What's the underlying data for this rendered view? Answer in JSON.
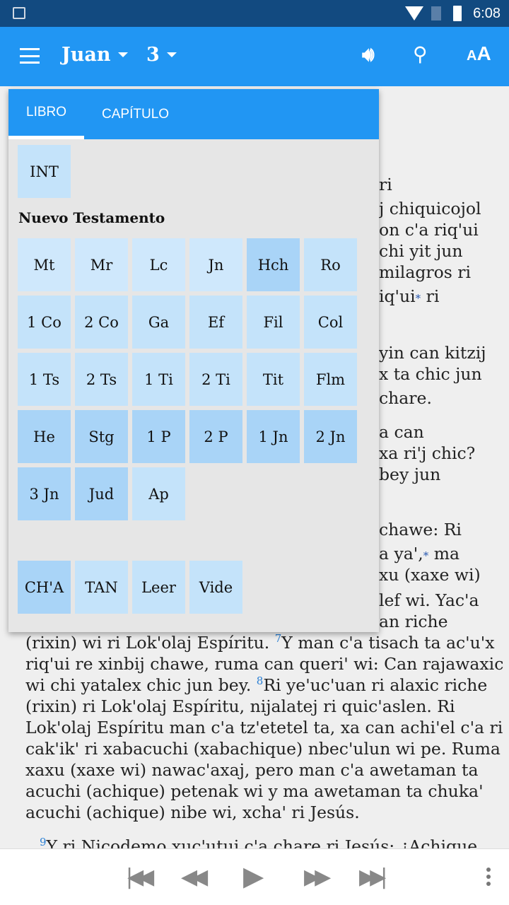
{
  "status": {
    "time": "6:08",
    "icons": [
      "gallery-icon",
      "wifi-icon",
      "no-sim-icon",
      "battery-icon"
    ]
  },
  "appbar": {
    "book": "Juan",
    "chapter": "3",
    "icons": [
      "menu-icon",
      "speaker-icon",
      "search-icon",
      "font-size-icon"
    ],
    "font_icon_text": "AA"
  },
  "popup": {
    "tabs": [
      "LIBRO",
      "CAPÍTULO"
    ],
    "intro": "INT",
    "section": "Nuevo Testamento",
    "books": [
      "Mt",
      "Mr",
      "Lc",
      "Jn",
      "Hch",
      "Ro",
      "1 Co",
      "2 Co",
      "Ga",
      "Ef",
      "Fil",
      "Col",
      "1 Ts",
      "2 Ts",
      "1 Ti",
      "2 Ti",
      "Tit",
      "Flm",
      "He",
      "Stg",
      "1 P",
      "2 P",
      "1 Jn",
      "2 Jn",
      "3 Jn",
      "Jud",
      "Ap"
    ],
    "extras": [
      "CH'A",
      "TAN",
      "Leer",
      "Vide"
    ]
  },
  "reader": {
    "fragments": [
      "ri",
      "j chiquicojol",
      "on c'a riq'ui",
      "chi yit jun",
      "milagros ri",
      "iq'ui",
      "ri",
      "yin can kitzij",
      "x ta chic jun",
      "chare.",
      "a can",
      "xa ri'j chic?",
      "bey jun",
      "chawe: Ri",
      "a ya',",
      "ma",
      "xu (xaxe wi)",
      "lef wi. Yac'a",
      "an riche"
    ],
    "footnote_mark": "*",
    "lines": [
      "(rixin) wi ri Lok'olaj Espíritu. ",
      "Y man c'a tisach ta ac'u'x",
      "riq'ui re xinbij chawe, ruma can queri' wi: Can rajawaxic",
      "wi chi yatalex chic jun bey. ",
      "Ri ye'uc'uan ri alaxic riche",
      "(rixin) ri Lok'olaj Espíritu, nijalatej ri quic'aslen. Ri",
      "Lok'olaj Espíritu man c'a tz'etetel ta, xa can achi'el c'a ri",
      "cak'ik' ri xabacuchi (xabachique) nbec'ulun wi pe. Ruma",
      "xaxu (xaxe wi) nawac'axaj, pero man c'a awetaman ta",
      "acuchi (achique) petenak wi y ma awetaman ta chuka'",
      "acuchi (achique) nibe wi, xcha' ri Jesús.",
      "Y ri Nicodemo xuc'utuj c'a chare ri Jesús: ¿Achique"
    ],
    "verse_numbers": [
      "7",
      "8",
      "9"
    ]
  },
  "player": {
    "icons": [
      "skip-first-icon",
      "rewind-icon",
      "play-icon",
      "fast-forward-icon",
      "skip-last-icon",
      "more-vert-icon"
    ]
  },
  "colors": {
    "accent": "#2196f3",
    "status_bar": "#124a80"
  }
}
